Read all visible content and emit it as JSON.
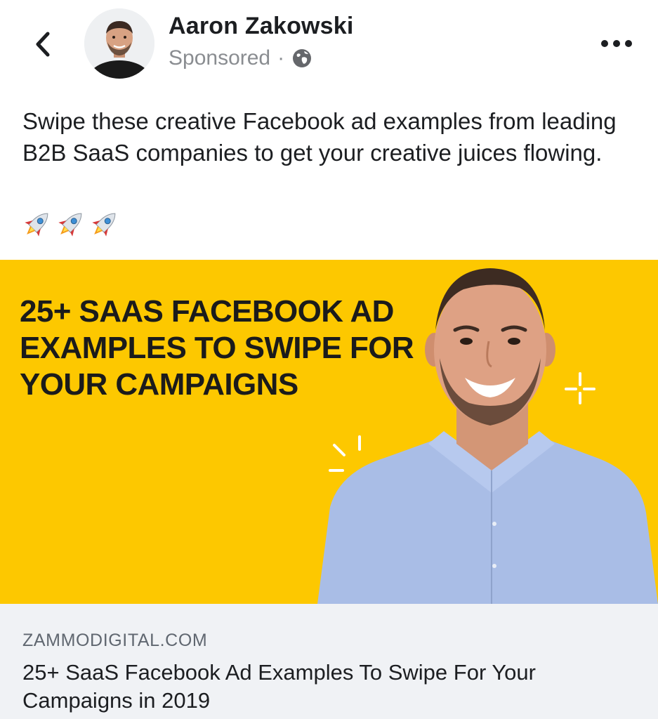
{
  "header": {
    "author_name": "Aaron Zakowski",
    "sponsored_label": "Sponsored",
    "separator": "·",
    "back_icon": "chevron-left-icon",
    "privacy_icon": "globe-icon",
    "more_icon": "more-options-icon"
  },
  "post": {
    "text": "Swipe these creative Facebook ad examples from leading B2B SaaS companies to get your creative juices flowing.",
    "emoji": [
      "🚀",
      "🚀",
      "🚀"
    ]
  },
  "ad_image": {
    "headline_lines": [
      "25+ SAAS FACEBOOK AD",
      "EXAMPLES TO SWIPE FOR",
      "YOUR CAMPAIGNS"
    ],
    "background_color": "#fdc800"
  },
  "link_preview": {
    "domain": "ZAMMODIGITAL.COM",
    "title": "25+ SaaS Facebook Ad Examples To Swipe For Your Campaigns in 2019"
  },
  "colors": {
    "text_primary": "#1c1e21",
    "text_secondary": "#8a8d91",
    "ad_yellow": "#fdc800",
    "link_card_bg": "#f0f2f5"
  }
}
